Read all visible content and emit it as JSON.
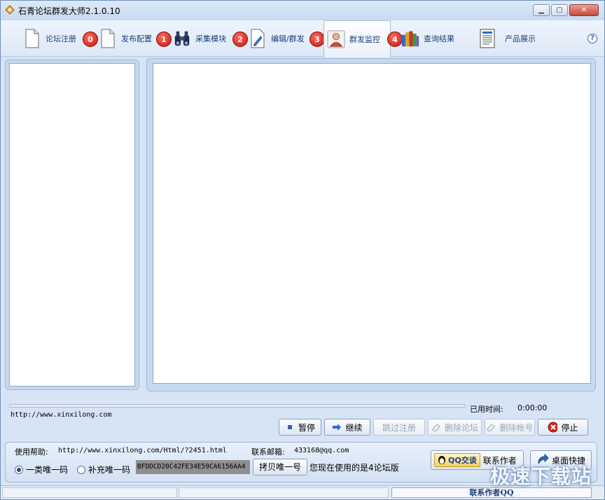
{
  "window": {
    "title": "石青论坛群发大师2.1.0.10"
  },
  "toolbar": {
    "tabs": [
      {
        "label": "论坛注册",
        "icon": "blank-page-icon"
      },
      {
        "label": "发布配置",
        "icon": "blank-page-icon",
        "badge": "0"
      },
      {
        "label": "采集模块",
        "icon": "binoculars-icon",
        "badge": "1"
      },
      {
        "label": "编辑/群发",
        "icon": "edit-pen-icon",
        "badge": "2"
      },
      {
        "label": "群发监控",
        "icon": "user-monitor-icon",
        "badge": "3",
        "active": true
      },
      {
        "label": "查询结果",
        "icon": "books-icon",
        "badge": "4"
      },
      {
        "label": "产品展示",
        "icon": "document-list-icon"
      }
    ]
  },
  "status": {
    "elapsed_label": "已用时间:",
    "elapsed_value": "0:00:00",
    "url": "http://www.xinxilong.com"
  },
  "actions": {
    "pause": "暂停",
    "resume": "继续",
    "skip_register": "跳过注册",
    "delete_forum": "删除论坛",
    "delete_account": "删除帐号",
    "stop": "停止"
  },
  "footer": {
    "help_label": "使用帮助:",
    "help_url": "http://www.xinxilong.com/Html/?2451.html",
    "mail_label": "联系邮箱:",
    "mail_value": "433168@qq.com",
    "radio_primary": "一类唯一码",
    "radio_secondary": "补充唯一码",
    "unique_code": "BFDDCD20C42FE34E59CA6156AA4",
    "copy_button": "拷贝唯一号",
    "version_note": "您现在使用的是4论坛版",
    "qq_chip": "QQ交谈",
    "contact_author": "联系作者",
    "desktop_shortcut": "桌面快捷"
  },
  "statusbar": {
    "qq_label": "联系作者QQ"
  },
  "watermark": "极速下载站"
}
